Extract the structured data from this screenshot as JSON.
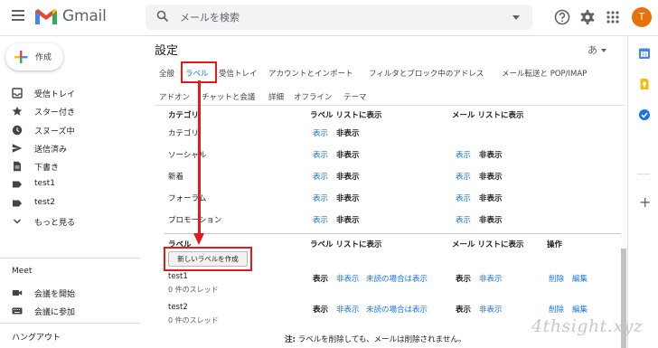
{
  "app": {
    "name": "Gmail"
  },
  "search": {
    "placeholder": "メールを検索"
  },
  "account": {
    "initial": "T",
    "color": "#e8710a"
  },
  "compose": {
    "label": "作成"
  },
  "nav": [
    {
      "label": "受信トレイ",
      "icon": "inbox-icon"
    },
    {
      "label": "スター付き",
      "icon": "star-icon"
    },
    {
      "label": "スヌーズ中",
      "icon": "clock-icon"
    },
    {
      "label": "送信済み",
      "icon": "send-icon"
    },
    {
      "label": "下書き",
      "icon": "draft-icon"
    },
    {
      "label": "test1",
      "icon": "label-icon"
    },
    {
      "label": "test2",
      "icon": "label-icon"
    },
    {
      "label": "もっと見る",
      "icon": "chevron-down-icon"
    }
  ],
  "meet": {
    "heading": "Meet",
    "items": [
      {
        "label": "会議を開始",
        "icon": "video-icon"
      },
      {
        "label": "会議に参加",
        "icon": "keyboard-icon"
      }
    ]
  },
  "hangouts": {
    "heading": "ハングアウト"
  },
  "settings": {
    "title": "設定",
    "language_toggle": "あ",
    "tabs": [
      "全般",
      "ラベル",
      "受信トレイ",
      "アカウントとインポート",
      "フィルタとブロック中のアドレス",
      "メール転送と POP/IMAP",
      "アドオン",
      "チャットと会議",
      "詳細",
      "オフライン",
      "テーマ"
    ],
    "active_tab": "ラベル",
    "system": {
      "headers": {
        "label": "カテゴリ",
        "label_list": "ラベル リストに表示",
        "message_list": "メール リストに表示"
      },
      "rows": [
        {
          "name": "カテゴリ",
          "show": "表示",
          "hide": "非表示"
        },
        {
          "name": "ソーシャル",
          "show": "表示",
          "hide": "非表示",
          "show2": "表示",
          "hide2": "非表示"
        },
        {
          "name": "新着",
          "show": "表示",
          "hide": "非表示",
          "show2": "表示",
          "hide2": "非表示"
        },
        {
          "name": "フォーラム",
          "show": "表示",
          "hide": "非表示",
          "show2": "表示",
          "hide2": "非表示"
        },
        {
          "name": "プロモーション",
          "show": "表示",
          "hide": "非表示",
          "show2": "表示",
          "hide2": "非表示"
        }
      ]
    },
    "user_labels": {
      "headers": {
        "label": "ラベル",
        "label_list": "ラベル リストに表示",
        "message_list": "メール リストに表示",
        "actions": "操作"
      },
      "create_button": "新しいラベルを作成",
      "rows": [
        {
          "name": "test1",
          "count": "0 件のスレッド",
          "show": "表示",
          "hide": "非表示",
          "unread": "未読の場合は表示",
          "show2": "表示",
          "hide2": "非表示",
          "remove": "削除",
          "edit": "編集"
        },
        {
          "name": "test2",
          "count": "0 件のスレッド",
          "show": "表示",
          "hide": "非表示",
          "unread": "未読の場合は表示",
          "show2": "表示",
          "hide2": "非表示",
          "remove": "削除",
          "edit": "編集"
        }
      ]
    },
    "note": {
      "prefix": "注:",
      "text": " ラベルを削除しても、メールは削除されません。"
    }
  },
  "colors": {
    "link": "#1a73e8",
    "highlight": "#e21b1b",
    "avatar": "#e8710a"
  },
  "watermark": "4thsight.xyz"
}
